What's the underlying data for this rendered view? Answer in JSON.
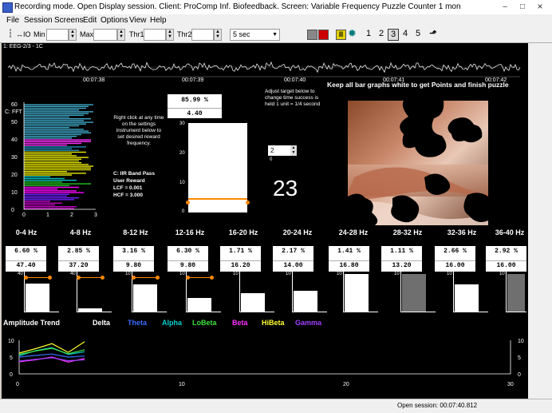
{
  "window": {
    "title": "Recording mode. Open Display session. Client: ProComp Inf. Biofeedback. Screen: Variable Frequency Puzzle Counter 1 mon",
    "minimize": "–",
    "maximize": "□",
    "close": "×"
  },
  "menu": [
    "File",
    "Session",
    "Screens",
    "Edit",
    "Options",
    "View",
    "Help"
  ],
  "toolbar": {
    "zoom_label": "↔IO",
    "min_label": "Min",
    "max_label": "Max",
    "thr1_label": "Thr1",
    "thr2_label": "Thr2",
    "time_select": "5 sec",
    "screen_nums": [
      "1",
      "2",
      "3",
      "4",
      "5"
    ],
    "active_screen": "3",
    "colors": {
      "stop": "#cc0000",
      "pause": "#e0d000",
      "gear": "#007a7a"
    }
  },
  "eeg": {
    "channel_label": "1: EEG-2/3 - 1C",
    "times": [
      "00:07:38",
      "00:07:39",
      "00:07:40",
      "00:07:41",
      "00:07:42"
    ]
  },
  "fft": {
    "label": "C: FFT",
    "yticks": [
      "60",
      "50",
      "40",
      "30",
      "20",
      "10",
      "0"
    ],
    "xticks": [
      "0",
      "1",
      "2",
      "3"
    ]
  },
  "info": {
    "right_click_hint": "Right click at any time on the settings instrument below to set desired reward frequency.",
    "band_pass": "C: IIR Band Pass",
    "user_reward": "User Reward",
    "lcf": "LCF = 0.001",
    "hcf": "HCF = 3.000",
    "adjust_hint": "Adjust target below to change time success is held 1 unit = 1/4 second",
    "target_value": "2",
    "target_zero": "0",
    "counter": "23",
    "instruction": "Keep all bar graphs white to get Points and finish puzzle"
  },
  "reward": {
    "pct": "85.99 %",
    "value": "4.40",
    "yticks": [
      "30",
      "20",
      "10",
      "0"
    ],
    "level_fraction": 0.15
  },
  "bands": [
    {
      "label": "0-4 Hz",
      "pct": "6.60 %",
      "value": "47.40",
      "ymax": "40",
      "fill": 0.72,
      "color": "#ffffff",
      "threshold": 0.9
    },
    {
      "label": "4-8 Hz",
      "pct": "2.85 %",
      "value": "37.20",
      "ymax": "40",
      "fill": 0.08,
      "color": "#ffffff",
      "threshold": 0.9
    },
    {
      "label": "8-12 Hz",
      "pct": "3.16 %",
      "value": "9.80",
      "ymax": "10",
      "fill": 0.7,
      "color": "#ffffff",
      "threshold": 0.9
    },
    {
      "label": "12-16 Hz",
      "pct": "6.30 %",
      "value": "9.80",
      "ymax": "10",
      "fill": 0.36,
      "color": "#ffffff",
      "threshold": 0.9
    },
    {
      "label": "16-20 Hz",
      "pct": "1.71 %",
      "value": "16.20",
      "ymax": "10",
      "fill": 0.48,
      "color": "#ffffff",
      "threshold": null
    },
    {
      "label": "20-24 Hz",
      "pct": "2.17 %",
      "value": "14.00",
      "ymax": "10",
      "fill": 0.55,
      "color": "#ffffff",
      "threshold": null
    },
    {
      "label": "24-28 Hz",
      "pct": "1.41 %",
      "value": "16.80",
      "ymax": "10",
      "fill": 0.97,
      "color": "#ffffff",
      "threshold": null
    },
    {
      "label": "28-32 Hz",
      "pct": "1.11 %",
      "value": "13.20",
      "ymax": "10",
      "fill": 0.97,
      "color": "#6f6f6f",
      "threshold": null
    },
    {
      "label": "32-36 Hz",
      "pct": "2.66 %",
      "value": "16.00",
      "ymax": "10",
      "fill": 0.7,
      "color": "#ffffff",
      "threshold": null
    },
    {
      "label": "36-40 Hz",
      "pct": "2.92 %",
      "value": "16.00",
      "ymax": "10",
      "fill": 0.97,
      "color": "#6f6f6f",
      "threshold": null
    }
  ],
  "trend": {
    "title": "Amplitude Trend",
    "legend": [
      {
        "name": "Delta",
        "color": "#ffffff"
      },
      {
        "name": "Theta",
        "color": "#3a6cff"
      },
      {
        "name": "Alpha",
        "color": "#00d0d0"
      },
      {
        "name": "LoBeta",
        "color": "#40e040"
      },
      {
        "name": "Beta",
        "color": "#ff30ff"
      },
      {
        "name": "HiBeta",
        "color": "#ffff30"
      },
      {
        "name": "Gamma",
        "color": "#a040ff"
      }
    ],
    "yticks_left": [
      "10",
      "5",
      "0"
    ],
    "yticks_right": [
      "10",
      "5",
      "0"
    ],
    "xticks": [
      "0",
      "10",
      "20",
      "30"
    ]
  },
  "chart_data": [
    {
      "type": "bar",
      "title": "C: FFT",
      "orientation": "horizontal",
      "xlim": [
        0,
        3
      ],
      "ylim": [
        0,
        60
      ],
      "categories": [
        "1",
        "2",
        "3",
        "4",
        "5",
        "6",
        "7",
        "8",
        "9",
        "10",
        "11",
        "12",
        "13",
        "14",
        "15",
        "16",
        "17",
        "18",
        "19",
        "20",
        "21",
        "22",
        "23",
        "24",
        "25",
        "26",
        "27",
        "28",
        "29",
        "30",
        "31",
        "32",
        "33",
        "34",
        "35",
        "36",
        "37",
        "38",
        "39",
        "40",
        "41",
        "42",
        "43",
        "44",
        "45",
        "46",
        "47",
        "48",
        "49",
        "50",
        "51",
        "52",
        "53",
        "54",
        "55",
        "56",
        "57",
        "58",
        "59",
        "60"
      ],
      "values": [
        2.1,
        2.2,
        1.3,
        1.6,
        1.1,
        2.1,
        2.3,
        1.8,
        1.9,
        2.5,
        2.2,
        1.4,
        2.3,
        1.9,
        2.8,
        1.6,
        2.2,
        1.7,
        1.1,
        2.0,
        2.6,
        1.8,
        2.8,
        2.8,
        2.9,
        2.7,
        2.4,
        2.3,
        2.4,
        2.7,
        2.2,
        2.0,
        2.6,
        2.3,
        2.0,
        2.6,
        1.8,
        2.4,
        2.8,
        2.8,
        2.0,
        2.2,
        2.4,
        2.8,
        2.7,
        2.5,
        1.9,
        2.3,
        2.6,
        2.9,
        2.5,
        2.8,
        1.9,
        2.5,
        2.7,
        2.9,
        2.3,
        2.6,
        2.7,
        2.9
      ],
      "colors": [
        "#c000c0",
        "#c000c0",
        "#c000c0",
        "#c000c0",
        "#c000c0",
        "#7020ff",
        "#7020ff",
        "#7020ff",
        "#7020ff",
        "#ff00ff",
        "#ff00ff",
        "#ff00ff",
        "#ff00ff",
        "#20c020",
        "#20c020",
        "#20c020",
        "#00c0c0",
        "#00c0c0",
        "#00c0c0",
        "#e8e800",
        "#e8e800",
        "#e8e800",
        "#e8e800",
        "#e8e800",
        "#e8e800",
        "#e8e800",
        "#e8e800",
        "#e8e800",
        "#e8e800",
        "#e8e800",
        "#e8e800",
        "#e8e800",
        "#e8e800",
        "#1f8ab0",
        "#1f8ab0",
        "#1f8ab0",
        "#ff30ff",
        "#ff30ff",
        "#ff30ff",
        "#ff30ff",
        "#40a8c8",
        "#40a8c8",
        "#40a8c8",
        "#40a8c8",
        "#40a8c8",
        "#40a8c8",
        "#40a8c8",
        "#40a8c8",
        "#40a8c8",
        "#40a8c8",
        "#40a8c8",
        "#40a8c8",
        "#40a8c8",
        "#40a8c8",
        "#40a8c8",
        "#40a8c8",
        "#40a8c8",
        "#40a8c8",
        "#40a8c8",
        "#40a8c8"
      ]
    },
    {
      "type": "line",
      "title": "Amplitude Trend",
      "x": [
        0,
        1,
        2,
        3,
        4
      ],
      "xlim": [
        0,
        30
      ],
      "ylim": [
        0,
        10
      ],
      "series": [
        {
          "name": "HiBeta",
          "values": [
            6.2,
            7.5,
            9.0,
            6.4,
            9.6
          ],
          "color": "#ffff30"
        },
        {
          "name": "Alpha",
          "values": [
            5.4,
            6.9,
            7.8,
            5.8,
            6.6
          ],
          "color": "#00d0d0"
        },
        {
          "name": "LoBeta",
          "values": [
            5.8,
            6.8,
            7.6,
            6.0,
            7.2
          ],
          "color": "#40e040"
        },
        {
          "name": "Theta",
          "values": [
            5.0,
            5.5,
            5.9,
            5.0,
            5.3
          ],
          "color": "#3a6cff"
        },
        {
          "name": "Beta",
          "values": [
            3.6,
            4.2,
            5.0,
            3.5,
            4.6
          ],
          "color": "#ff30ff"
        },
        {
          "name": "Gamma",
          "values": [
            3.8,
            4.3,
            4.8,
            3.9,
            4.2
          ],
          "color": "#a040ff"
        }
      ]
    }
  ],
  "status": "Open session: 00:07:40.812"
}
